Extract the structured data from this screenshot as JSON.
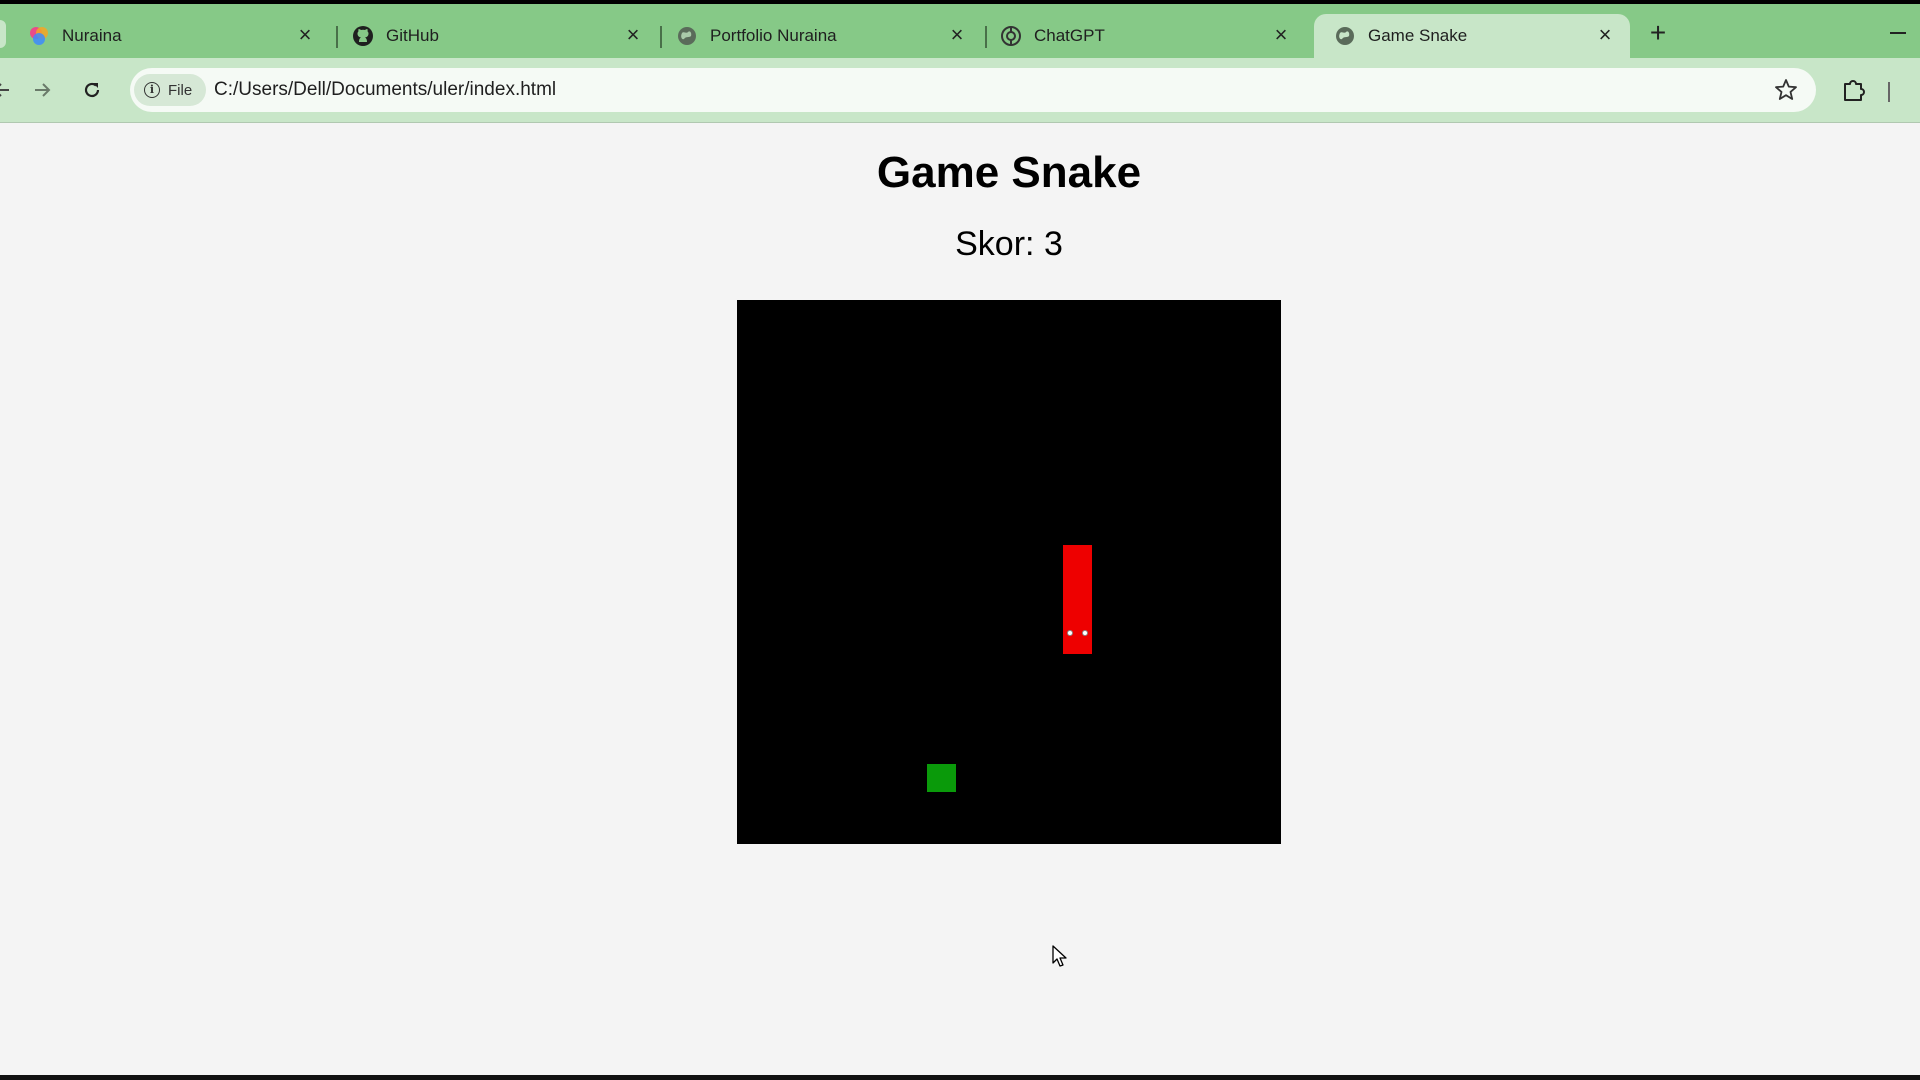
{
  "browser": {
    "tabs": [
      {
        "label": "Nuraina",
        "icon": "colorful-logo-icon",
        "active": false
      },
      {
        "label": "GitHub",
        "icon": "github-icon",
        "active": false
      },
      {
        "label": "Portfolio Nuraina",
        "icon": "globe-icon",
        "active": false
      },
      {
        "label": "ChatGPT",
        "icon": "chatgpt-icon",
        "active": false
      },
      {
        "label": "Game Snake",
        "icon": "globe-icon",
        "active": true
      }
    ],
    "site_chip": "File",
    "url": "C:/Users/Dell/Documents/uler/index.html"
  },
  "game": {
    "title": "Game Snake",
    "score_label": "Skor:",
    "score_value": "3",
    "colors": {
      "board": "#000000",
      "snake": "#ee0000",
      "food": "#0a9a0a",
      "accent": "#86c987"
    }
  }
}
